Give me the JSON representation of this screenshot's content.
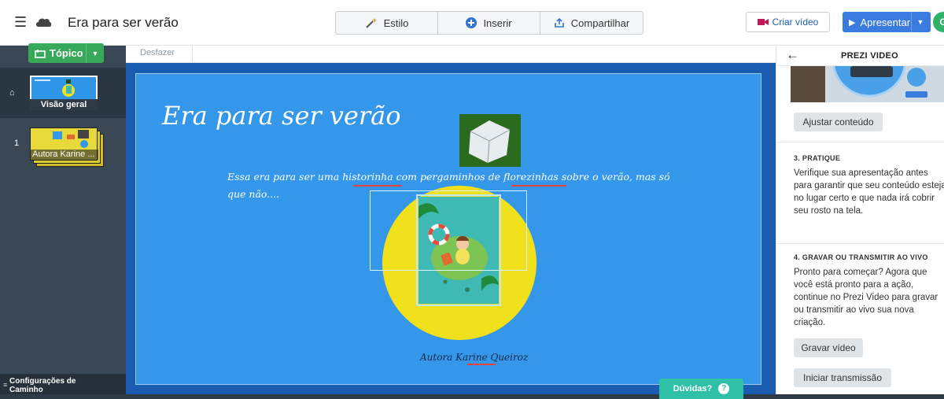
{
  "header": {
    "title": "Era para ser verão",
    "tabs": [
      "Estilo",
      "Inserir",
      "Compartilhar"
    ],
    "criar_video": "Criar vídeo",
    "apresentar": "Apresentar",
    "avatar_letter": "G"
  },
  "left_panel": {
    "topico_label": "Tópico",
    "overview_label": "Visão geral",
    "slide_number": "1",
    "slide_label": "Autora Karine ...",
    "config_label_1": "Configurações de",
    "config_label_2": "Caminho"
  },
  "toolbar": {
    "desfazer": "Desfazer"
  },
  "slide": {
    "title": "Era para ser verão",
    "text_1": "Essa era para ser uma historinha com pergaminhos de florezinhas sobre o verão, mas só",
    "text_2": "que não....",
    "author": "Autora  Karine Queiroz"
  },
  "help_button": "Dúvidas?",
  "right_panel": {
    "title": "PREZI VIDEO",
    "ajustar": "Ajustar conteúdo",
    "section3_head": "3. PRATIQUE",
    "section3_body": "Verifique sua apresentação antes para garantir que seu conteúdo esteja no lugar certo e que nada irá cobrir seu rosto na tela.",
    "section4_head": "4. GRAVAR OU TRANSMITIR AO VIVO",
    "section4_body": "Pronto para começar? Agora que você está pronto para a ação, continue no Prezi Video para gravar ou transmitir ao vivo sua nova criação.",
    "gravar": "Gravar vídeo",
    "iniciar": "Iniciar transmissão"
  },
  "colors": {
    "accent_blue": "#3a7be0",
    "topic_green": "#38a85a",
    "slide_blue": "#3497e9",
    "help_teal": "#2fc0a8"
  }
}
